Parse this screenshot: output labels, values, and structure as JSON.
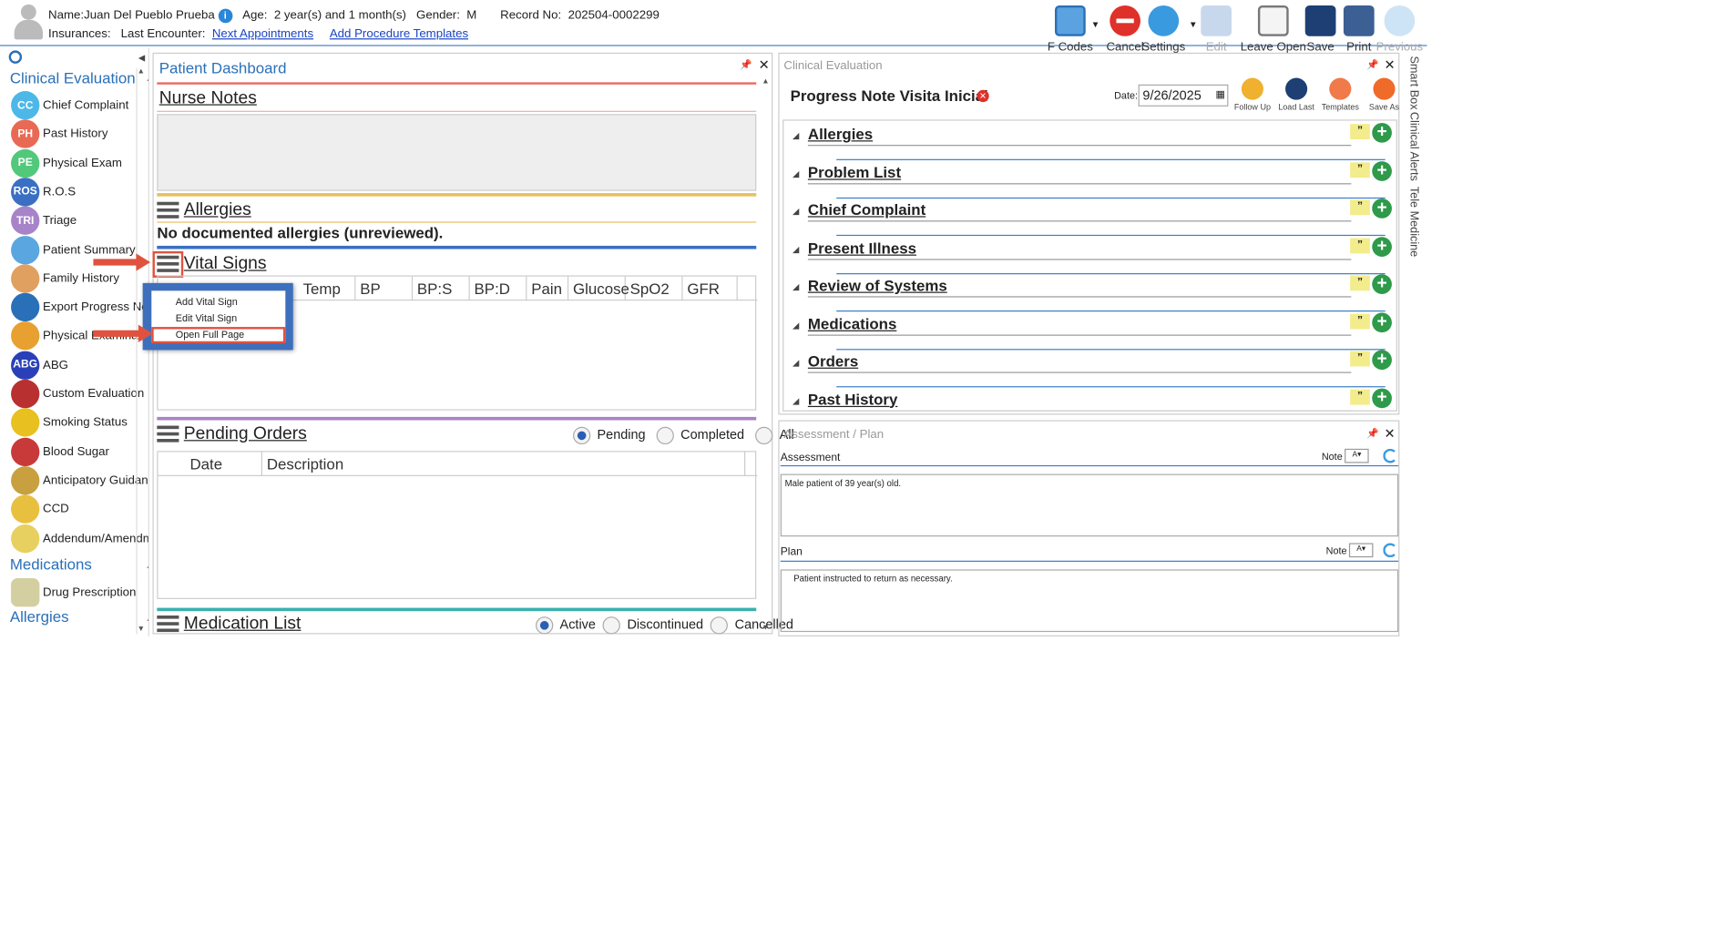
{
  "patient": {
    "name_label": "Name:",
    "name": "Juan Del Pueblo Prueba",
    "age_label": "Age:",
    "age": "2 year(s) and 1 month(s)",
    "gender_label": "Gender:",
    "gender": "M",
    "record_label": "Record No:",
    "record": "202504-0002299",
    "insurances_label": "Insurances:",
    "last_encounter_label": "Last Encounter:",
    "next_appointments": "Next Appointments",
    "add_procedure_templates": "Add Procedure Templates"
  },
  "toolbar": {
    "fcodes": "F Codes",
    "cancel": "Cancel",
    "settings": "Settings",
    "edit": "Edit",
    "leave_open": "Leave Open",
    "save": "Save",
    "print": "Print",
    "previous": "Previous"
  },
  "sidebar": {
    "clinical_header": "Clinical Evaluation",
    "items": [
      {
        "label": "Chief Complaint",
        "abbr": "CC",
        "color": "#4db8e8"
      },
      {
        "label": "Past History",
        "abbr": "PH",
        "color": "#e86a55"
      },
      {
        "label": "Physical Exam",
        "abbr": "PE",
        "color": "#52c87a"
      },
      {
        "label": "R.O.S",
        "abbr": "ROS",
        "color": "#3a6fc4"
      },
      {
        "label": "Triage",
        "abbr": "TRI",
        "color": "#a784c8"
      },
      {
        "label": "Patient Summary",
        "abbr": "",
        "color": "#5aa6e0"
      },
      {
        "label": "Family History",
        "abbr": "",
        "color": "#e0a060"
      },
      {
        "label": "Export Progress Notes",
        "abbr": "",
        "color": "#2a70b8"
      },
      {
        "label": "Physical Examination",
        "abbr": "",
        "color": "#e8a030"
      },
      {
        "label": "ABG",
        "abbr": "ABG",
        "color": "#2a40b8"
      },
      {
        "label": "Custom Evaluation",
        "abbr": "",
        "color": "#b83030"
      },
      {
        "label": "Smoking Status",
        "abbr": "",
        "color": "#e8c020"
      },
      {
        "label": "Blood Sugar",
        "abbr": "",
        "color": "#c83a3a"
      },
      {
        "label": "Anticipatory Guidance",
        "abbr": "",
        "color": "#c8a040"
      },
      {
        "label": "CCD",
        "abbr": "",
        "color": "#e8c040"
      },
      {
        "label": "Addendum/Amendments",
        "abbr": "",
        "color": "#e8d060"
      }
    ],
    "medications_header": "Medications",
    "med_items": [
      {
        "label": "Drug Prescription"
      }
    ],
    "allergies_header": "Allergies"
  },
  "dashboard": {
    "title": "Patient Dashboard",
    "nurse_notes": "Nurse Notes",
    "allergies": "Allergies",
    "allergies_text": "No documented allergies (unreviewed).",
    "vital_signs": "Vital Signs",
    "vital_cols": [
      "Temp",
      "BP",
      "BP:S",
      "BP:D",
      "Pain",
      "Glucose",
      "SpO2",
      "GFR"
    ],
    "pending_orders": "Pending Orders",
    "pending_filters": [
      "Pending",
      "Completed",
      "All"
    ],
    "orders_cols": [
      "Date",
      "Description"
    ],
    "medication_list": "Medication List",
    "med_filters": [
      "Active",
      "Discontinued",
      "Cancelled"
    ]
  },
  "context_menu": {
    "items": [
      "Add Vital Sign",
      "Edit Vital Sign",
      "Open Full Page"
    ]
  },
  "clinical": {
    "title": "Clinical Evaluation",
    "note_title": "Progress Note Visita Inicial",
    "date_label": "Date:",
    "date": "9/26/2025",
    "actions": [
      "Follow Up",
      "Load Last",
      "Templates",
      "Save As"
    ],
    "sections": [
      "Allergies",
      "Problem List",
      "Chief Complaint",
      "Present Illness",
      "Review of Systems",
      "Medications",
      "Orders",
      "Past History"
    ]
  },
  "assessment": {
    "title": "Assessment / Plan",
    "assessment_label": "Assessment",
    "note_label": "Note",
    "assessment_text": "Male patient of 39 year(s) old.",
    "plan_label": "Plan",
    "plan_text": "Patient instructed to return as necessary."
  },
  "side_tabs": [
    "Smart Box",
    "Clinical Alerts",
    "Tele Medicine"
  ]
}
